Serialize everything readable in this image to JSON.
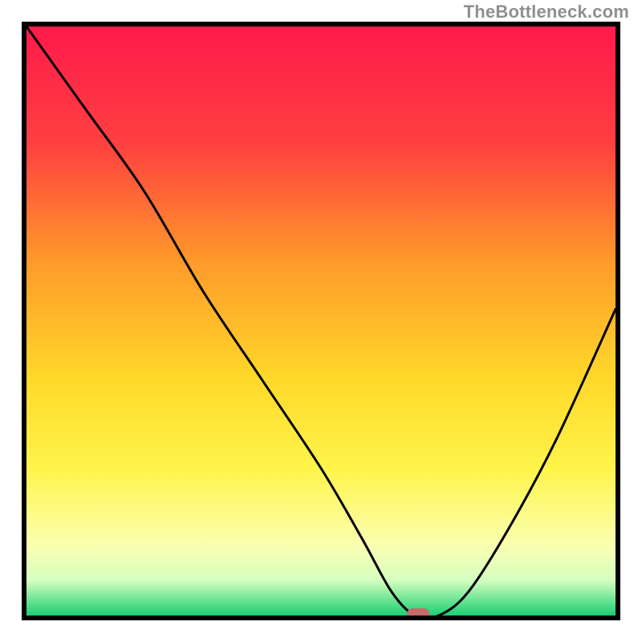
{
  "attribution": "TheBottleneck.com",
  "chart_data": {
    "type": "line",
    "title": "",
    "xlabel": "",
    "ylabel": "",
    "xlim": [
      0,
      100
    ],
    "ylim": [
      0,
      100
    ],
    "grid": false,
    "legend": false,
    "background_gradient": [
      {
        "y": 0,
        "color": "#ff1a4b"
      },
      {
        "y": 20,
        "color": "#ff4040"
      },
      {
        "y": 40,
        "color": "#ff9a2a"
      },
      {
        "y": 60,
        "color": "#ffd92a"
      },
      {
        "y": 75,
        "color": "#fff44a"
      },
      {
        "y": 88,
        "color": "#fbffb0"
      },
      {
        "y": 94,
        "color": "#d5ffc0"
      },
      {
        "y": 100,
        "color": "#1acf72"
      }
    ],
    "series": [
      {
        "name": "bottleneck-curve",
        "x": [
          0,
          10,
          20,
          30,
          40,
          50,
          57,
          62,
          66,
          70,
          75,
          82,
          90,
          100
        ],
        "y": [
          100,
          86,
          72,
          55,
          40,
          25,
          13,
          4,
          0,
          0,
          4,
          15,
          30,
          52
        ]
      }
    ],
    "marker": {
      "name": "selected-point",
      "x": 66.5,
      "y": 0,
      "color": "#c66a6a"
    }
  }
}
